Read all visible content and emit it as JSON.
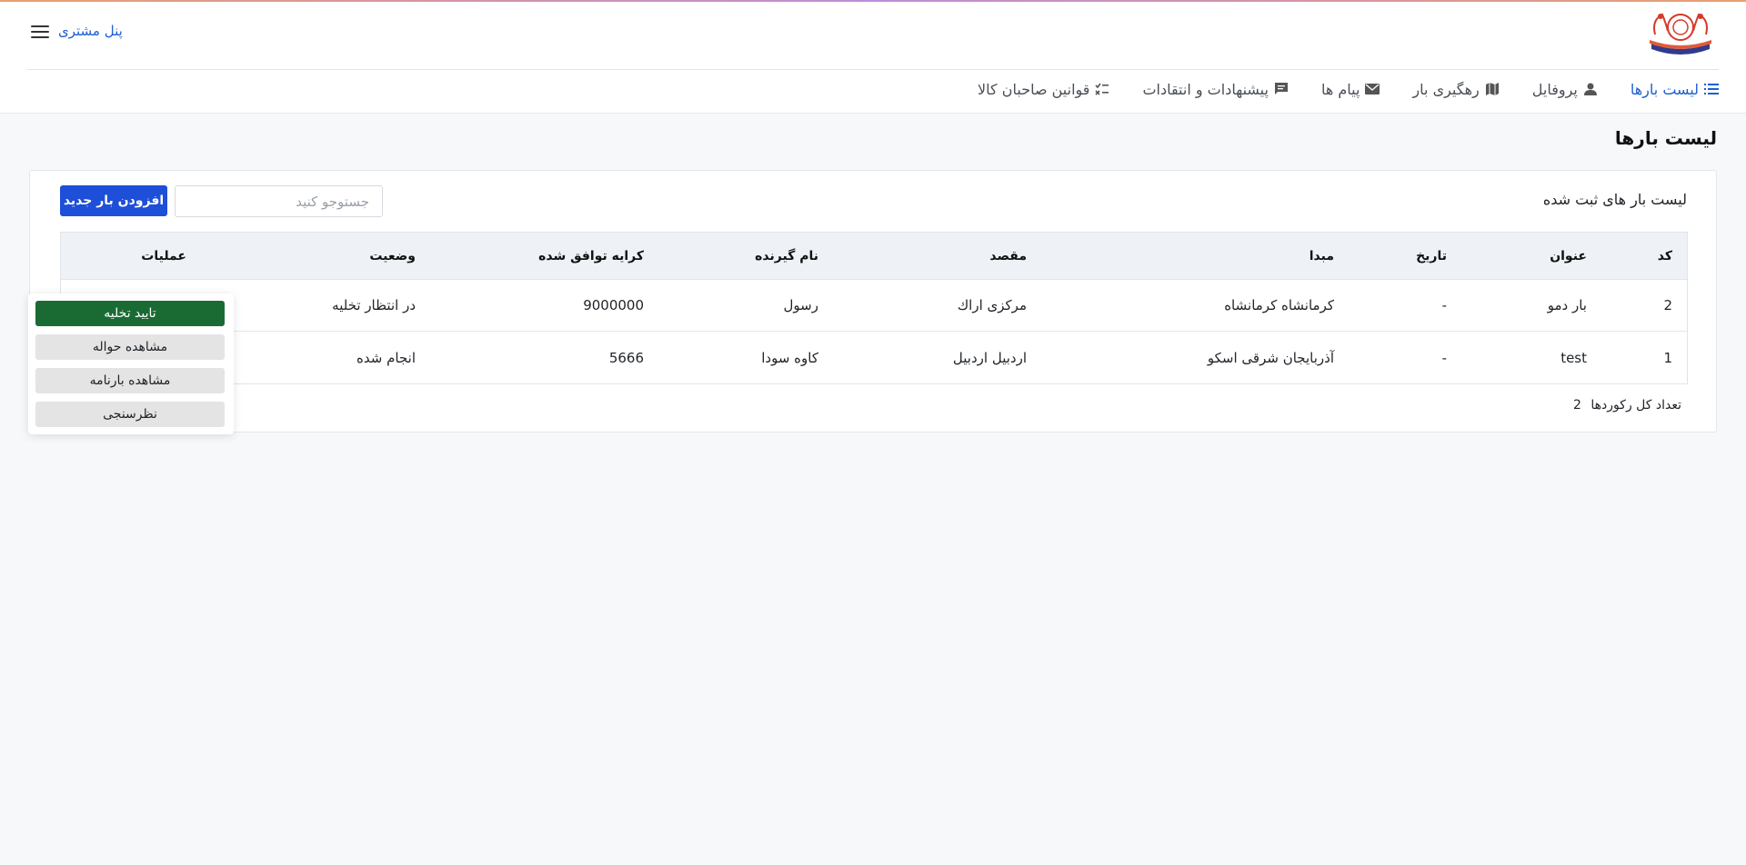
{
  "header": {
    "panel_label": "پنل مشتری",
    "nav": [
      {
        "label": "لیست بارها",
        "icon": "list-icon",
        "active": true
      },
      {
        "label": "پروفایل",
        "icon": "person-icon"
      },
      {
        "label": "رهگیری بار",
        "icon": "map-icon"
      },
      {
        "label": "پیام ها",
        "icon": "mail-icon"
      },
      {
        "label": "پیشنهادات و انتقادات",
        "icon": "feedback-icon"
      },
      {
        "label": "قوانین صاحبان کالا",
        "icon": "rule-icon"
      }
    ]
  },
  "page": {
    "title": "لیست بارها"
  },
  "card": {
    "title": "لیست بار های ثبت شده",
    "search_placeholder": "جستوجو کنید",
    "add_button": "افزودن بار جدید"
  },
  "table": {
    "columns": [
      "کد",
      "عنوان",
      "تاریخ",
      "مبدا",
      "مقصد",
      "نام گیرنده",
      "کرایه توافق شده",
      "وضعیت",
      "عملیات"
    ],
    "rows": [
      {
        "code": "2",
        "title": "بار دمو",
        "date": "-",
        "origin": "کرمانشاه کرمانشاه",
        "dest": "مرکزی اراك",
        "receiver": "رسول",
        "fare": "9000000",
        "status": "در انتظار تخلیه"
      },
      {
        "code": "1",
        "title": "test",
        "date": "-",
        "origin": "آذربایجان شرقی اسکو",
        "dest": "اردبیل اردبیل",
        "receiver": "کاوه سودا",
        "fare": "5666",
        "status": "انجام شده"
      }
    ]
  },
  "records": {
    "label": "تعداد کل رکوردها",
    "count": "2"
  },
  "dropdown": {
    "items": [
      "تایید تخلیه",
      "مشاهده حواله",
      "مشاهده بارنامه",
      "نظرسنجی"
    ]
  },
  "colors": {
    "accent": "#1d4fd8",
    "link": "#1d5fd1",
    "confirm": "#1a6b33"
  }
}
